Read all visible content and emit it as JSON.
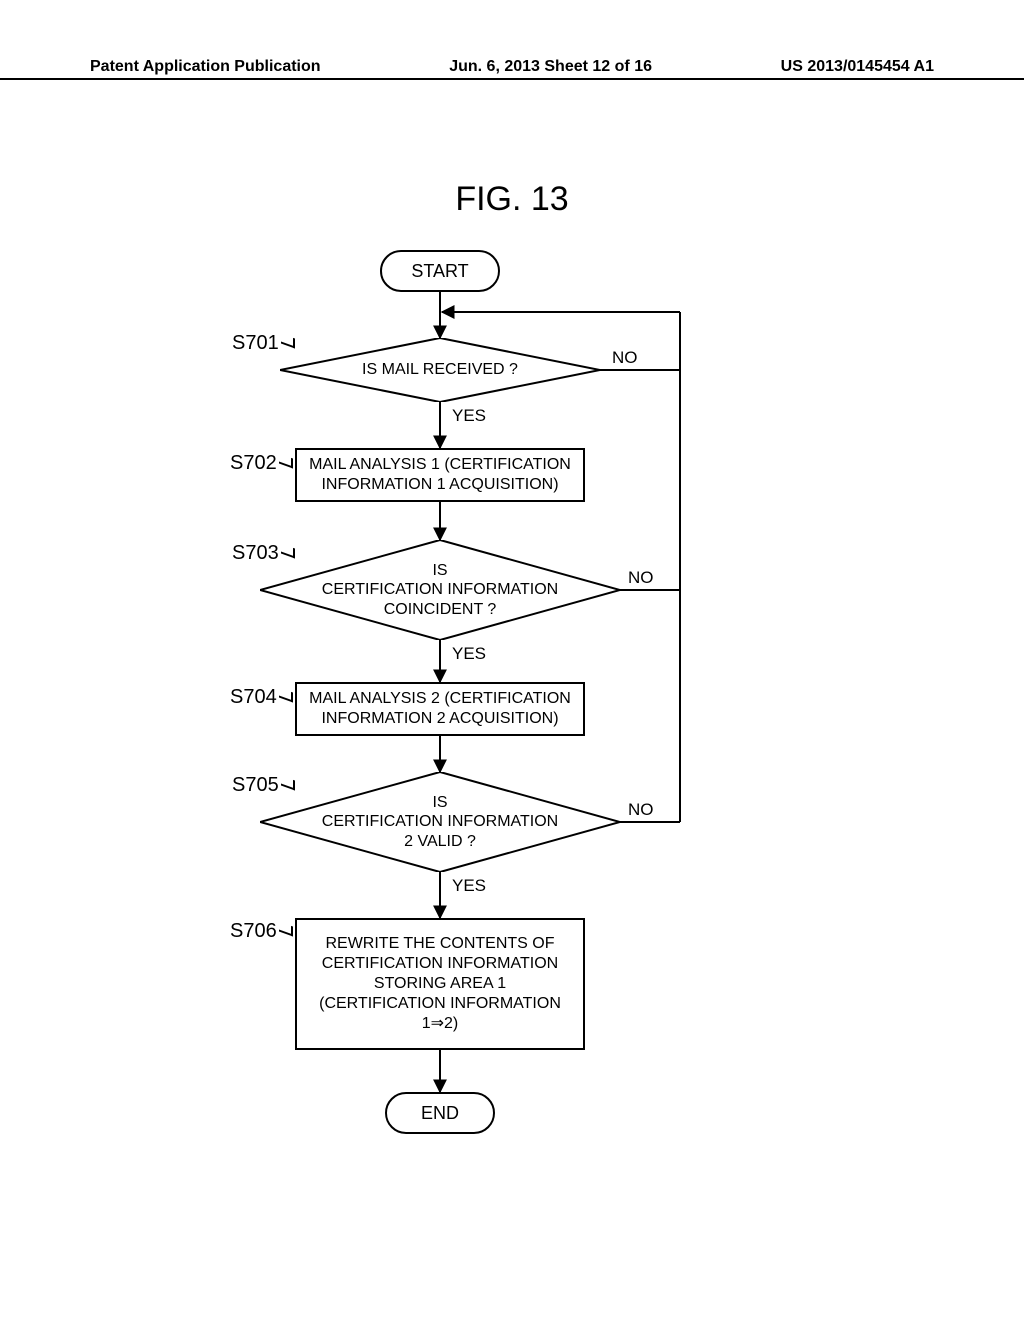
{
  "header": {
    "left": "Patent Application Publication",
    "center": "Jun. 6, 2013   Sheet 12 of 16",
    "right": "US 2013/0145454 A1"
  },
  "figure_title": "FIG. 13",
  "labels": {
    "yes": "YES",
    "no": "NO"
  },
  "steps": {
    "start": "START",
    "end": "END",
    "s701": {
      "id": "S701",
      "text": "IS MAIL RECEIVED ?"
    },
    "s702": {
      "id": "S702",
      "text": "MAIL ANALYSIS 1 (CERTIFICATION INFORMATION 1 ACQUISITION)"
    },
    "s703": {
      "id": "S703",
      "text": "IS\nCERTIFICATION INFORMATION\nCOINCIDENT ?"
    },
    "s704": {
      "id": "S704",
      "text": "MAIL ANALYSIS 2 (CERTIFICATION INFORMATION 2 ACQUISITION)"
    },
    "s705": {
      "id": "S705",
      "text": "IS\nCERTIFICATION INFORMATION\n2 VALID ?"
    },
    "s706": {
      "id": "S706",
      "text": "REWRITE THE CONTENTS OF\nCERTIFICATION INFORMATION\nSTORING AREA 1\n(CERTIFICATION INFORMATION\n1⇒2)"
    }
  }
}
